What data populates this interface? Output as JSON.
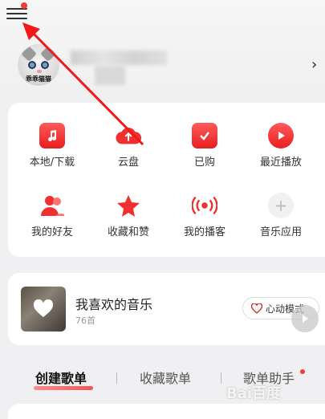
{
  "profile": {
    "avatar_caption": "乖乖猫猫"
  },
  "grid": {
    "row1": [
      {
        "label": "本地/下载",
        "icon": "music-note-icon"
      },
      {
        "label": "云盘",
        "icon": "cloud-upload-icon"
      },
      {
        "label": "已购",
        "icon": "shopping-bag-icon"
      },
      {
        "label": "最近播放",
        "icon": "play-icon"
      }
    ],
    "row2": [
      {
        "label": "我的好友",
        "icon": "friends-icon"
      },
      {
        "label": "收藏和赞",
        "icon": "star-icon"
      },
      {
        "label": "我的播客",
        "icon": "podcast-icon"
      },
      {
        "label": "音乐应用",
        "icon": "plus-icon"
      }
    ]
  },
  "favorites": {
    "title": "我喜欢的音乐",
    "count": "76首",
    "heartbeat_label": "心动模式"
  },
  "tabs": [
    {
      "label": "创建歌单",
      "active": true
    },
    {
      "label": "收藏歌单",
      "active": false
    },
    {
      "label": "歌单助手",
      "active": false
    }
  ],
  "watermark": "Bai百度",
  "colors": {
    "accent": "#f23b3b",
    "annotation_arrow": "#f01818"
  }
}
